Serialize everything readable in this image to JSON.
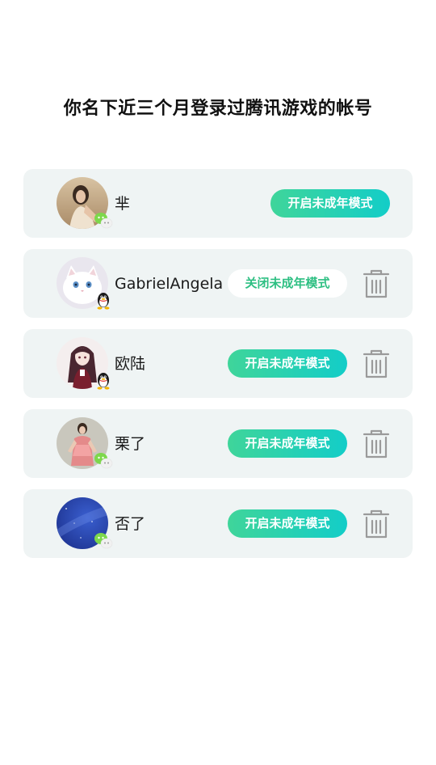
{
  "page": {
    "title": "你名下近三个月登录过腾讯游戏的帐号"
  },
  "accounts": [
    {
      "name": "芈",
      "platform": "wechat-icon",
      "mode_label": "开启未成年模式",
      "mode_state": "on",
      "deletable": false
    },
    {
      "name": "GabrielAngela",
      "platform": "qq-icon",
      "mode_label": "关闭未成年模式",
      "mode_state": "off",
      "deletable": true
    },
    {
      "name": "欧陆",
      "platform": "qq-icon",
      "mode_label": "开启未成年模式",
      "mode_state": "on",
      "deletable": true
    },
    {
      "name": "栗了",
      "platform": "wechat-icon",
      "mode_label": "开启未成年模式",
      "mode_state": "on",
      "deletable": true
    },
    {
      "name": "否了",
      "platform": "wechat-icon",
      "mode_label": "开启未成年模式",
      "mode_state": "on",
      "deletable": true
    }
  ],
  "colors": {
    "card_bg": "#eff4f4",
    "button_gradient_start": "#3fd59a",
    "button_gradient_end": "#13cdc8",
    "off_button_text": "#2dbf82",
    "trash_icon": "#9a9a9a"
  }
}
